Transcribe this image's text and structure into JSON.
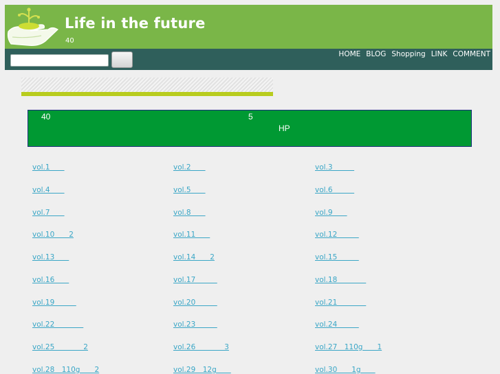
{
  "header": {
    "title": "Life in the future",
    "subtitle": "40"
  },
  "search": {
    "placeholder": "",
    "button_label": ""
  },
  "nav": [
    "HOME",
    "BLOG",
    "Shopping",
    "LINK",
    "COMMENT"
  ],
  "notice": {
    "text_a": "40",
    "text_b": "5",
    "text_c": "HP"
  },
  "links": [
    "vol.1　　",
    "vol.2　　",
    "vol.3　　　",
    "vol.4　　",
    "vol.5　　",
    "vol.6　　　",
    "vol.7　　",
    "vol.8　　",
    "vol.9　　",
    "vol.10　　2",
    "vol.11　　",
    "vol.12　　　",
    "vol.13　　",
    "vol.14　　2",
    "vol.15　　　",
    "vol.16　　",
    "vol.17　　　",
    "vol.18　　　　",
    "vol.19　　　",
    "vol.20　　　",
    "vol.21　　　　",
    "vol.22　　　　",
    "vol.23　　　",
    "vol.24　　　",
    "vol.25　　　　2",
    "vol.26　　　　3",
    "vol.27　110g　　1",
    "vol.28　110g　　2",
    "vol.29　12g　　",
    "vol.30　　1g　　"
  ]
}
